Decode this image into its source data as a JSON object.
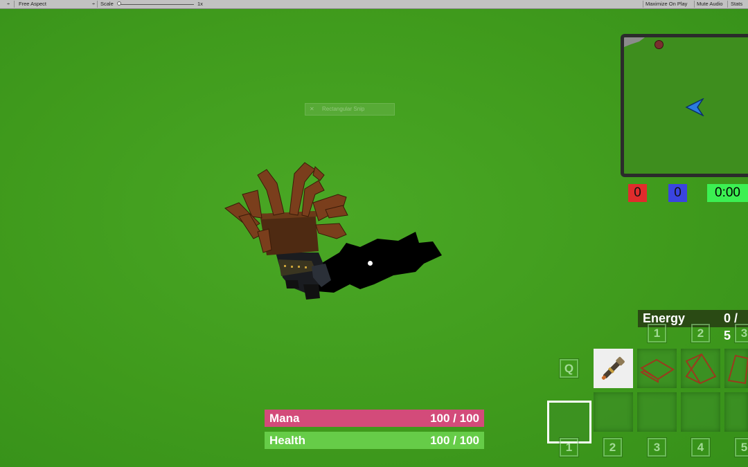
{
  "toolbar": {
    "aspect": "Free Aspect",
    "scale_label": "Scale",
    "scale_value": "1x",
    "maximize": "Maximize On Play",
    "mute": "Mute Audio",
    "stats": "Stats"
  },
  "overlay": {
    "snip_close": "✕",
    "snip_title": "Rectangular Snip"
  },
  "scores": {
    "red": "0",
    "blue": "0",
    "timer": "0:00",
    "colors": {
      "red": "#e12c2c",
      "blue": "#3a44e0",
      "timer": "#3cf052"
    }
  },
  "energy": {
    "label": "Energy",
    "value": "0 / 5"
  },
  "ability_keys": [
    "1",
    "2",
    "3"
  ],
  "q_key": "Q",
  "inventory_keys": [
    "1",
    "2",
    "3",
    "4",
    "5"
  ],
  "icons": {
    "minimap_player": "blue-arrow-icon",
    "minimap_enemy": "red-dot-icon",
    "slot_wand": "wand-icon",
    "slot_floor": "wire-square-icon",
    "slot_wall": "wire-wall-icon",
    "slot_ramp": "wire-ramp-icon"
  },
  "bars": {
    "mana": {
      "label": "Mana",
      "value": "100 / 100",
      "fraction": 1.0,
      "color": "#d34b7a"
    },
    "health": {
      "label": "Health",
      "value": "100 / 100",
      "fraction": 1.0,
      "color": "#66cc48"
    }
  }
}
